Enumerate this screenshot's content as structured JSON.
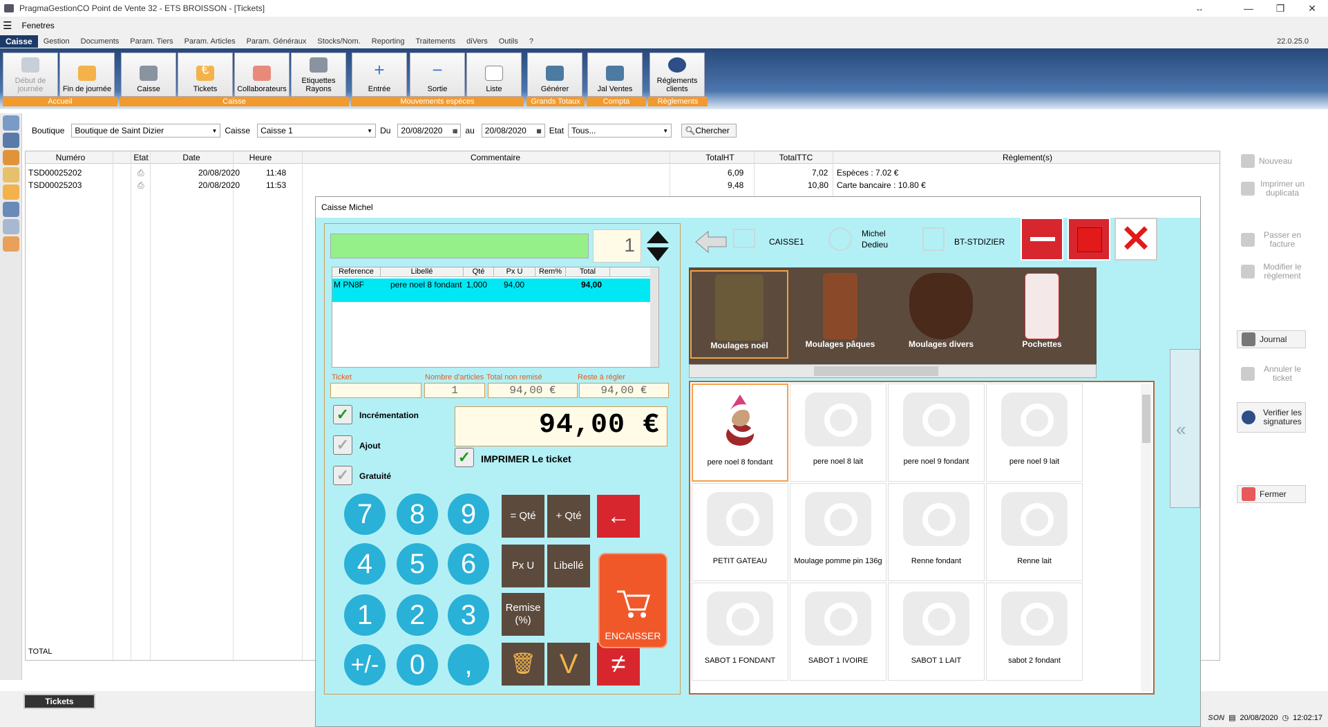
{
  "window": {
    "title": "PragmaGestionCO Point de Vente 32 - ETS BROISSON - [Tickets]"
  },
  "menu": {
    "item": "Fenetres"
  },
  "nav": {
    "items": [
      "Caisse",
      "Gestion",
      "Documents",
      "Param. Tiers",
      "Param. Articles",
      "Param. Généraux",
      "Stocks/Nom.",
      "Reporting",
      "Traitements",
      "diVers",
      "Outils",
      "?"
    ],
    "version": "22.0.25.0"
  },
  "ribbon": {
    "buttons": [
      "Début de journée",
      "Fin de journée",
      "Caisse",
      "Tickets",
      "Collaborateurs",
      "Etiquettes Rayons",
      "Entrée",
      "Sortie",
      "Liste",
      "Générer",
      "Jal Ventes",
      "Réglements clients"
    ],
    "groups": [
      "Accueil",
      "Caisse",
      "Mouvements espèces",
      "Grands Totaux",
      "Compta",
      "Règlements"
    ]
  },
  "filter": {
    "boutique_label": "Boutique",
    "boutique": "Boutique de Saint Dizier",
    "caisse_label": "Caisse",
    "caisse": "Caisse 1",
    "du_label": "Du",
    "du": "20/08/2020",
    "au_label": "au",
    "au": "20/08/2020",
    "etat_label": "Etat",
    "etat": "Tous...",
    "search": "Chercher"
  },
  "grid": {
    "headers": [
      "Numéro",
      "Etat",
      "Date",
      "Heure",
      "Commentaire",
      "TotalHT",
      "TotalTTC",
      "Règlement(s)"
    ],
    "rows": [
      {
        "numero": "TSD00025202",
        "date": "20/08/2020",
        "heure": "11:48",
        "ht": "6,09",
        "ttc": "7,02",
        "reglement": "Espèces : 7.02 €"
      },
      {
        "numero": "TSD00025203",
        "date": "20/08/2020",
        "heure": "11:53",
        "ht": "9,48",
        "ttc": "10,80",
        "reglement": "Carte bancaire : 10.80 €"
      }
    ],
    "total_label": "TOTAL"
  },
  "rightside": {
    "nouveau": "Nouveau",
    "imprimer": "Imprimer un duplicata",
    "passer": "Passer en facture",
    "modifier": "Modifier le règlement",
    "journal": "Journal",
    "annuler": "Annuler le ticket",
    "verifier": "Verifier les signatures",
    "fermer": "Fermer"
  },
  "bottom": {
    "tab": "Tickets",
    "date": "20/08/2020",
    "time": "12:02:17",
    "brand": "SON"
  },
  "dialog": {
    "title": "Caisse Michel",
    "qty": "1",
    "ticket_headers": [
      "Reference",
      "Libellé",
      "Qté",
      "Px U",
      "Rem%",
      "Total"
    ],
    "ticket_row": {
      "ref": "M PN8F",
      "lib": "pere noel 8 fondant",
      "qte": "1,000",
      "pxu": "94,00",
      "rem": "",
      "total": "94,00"
    },
    "field_labels": [
      "Ticket",
      "Nombre d'articles",
      "Total non remisé",
      "Reste à régler"
    ],
    "field_values": [
      "",
      "1",
      "94,00 €",
      "94,00 €"
    ],
    "total": "94,00 €",
    "checks": [
      "Incrémentation",
      "Ajout",
      "Gratuité"
    ],
    "print_label": "IMPRIMER Le ticket",
    "keys": {
      "eq_qty": "= Qté",
      "plus_qty": "+ Qté",
      "pxu": "Px U",
      "libelle": "Libellé",
      "remise": "Remise (%)",
      "encaisser": "ENCAISSER"
    },
    "digits": [
      "7",
      "8",
      "9",
      "4",
      "5",
      "6",
      "1",
      "2",
      "3",
      "+/-",
      "0",
      ","
    ],
    "header": {
      "caisse": "CAISSE1",
      "user1": "Michel",
      "user2": "Dedieu",
      "store": "BT-STDIZIER"
    },
    "categories": [
      "Moulages noël",
      "Moulages pâques",
      "Moulages divers",
      "Pochettes"
    ],
    "products": [
      "pere noel 8 fondant",
      "pere noel 8 lait",
      "pere noel 9 fondant",
      "pere noel 9 lait",
      "PETIT GATEAU",
      "Moulage pomme pin 136g",
      "Renne fondant",
      "Renne lait",
      "SABOT 1 FONDANT",
      "SABOT 1 IVOIRE",
      "SABOT 1 LAIT",
      "sabot 2 fondant"
    ]
  }
}
